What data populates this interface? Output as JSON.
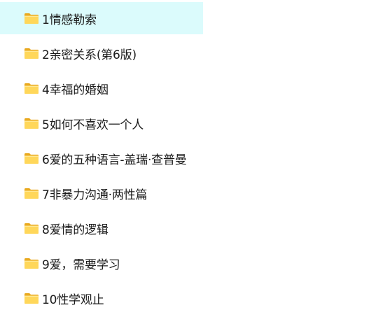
{
  "folders": [
    {
      "name": "1情感勒索",
      "selected": true
    },
    {
      "name": "2亲密关系(第6版)",
      "selected": false
    },
    {
      "name": "4幸福的婚姻",
      "selected": false
    },
    {
      "name": "5如何不喜欢一个人",
      "selected": false
    },
    {
      "name": "6爱的五种语言-盖瑞·查普曼",
      "selected": false
    },
    {
      "name": "7非暴力沟通·两性篇",
      "selected": false
    },
    {
      "name": "8爱情的逻辑",
      "selected": false
    },
    {
      "name": "9爱，需要学习",
      "selected": false
    },
    {
      "name": "10性学观止",
      "selected": false
    }
  ],
  "icon": "folder-icon",
  "colors": {
    "selection": "#dbfbfc",
    "folder_front": "#ffd75a",
    "folder_back": "#f0b429",
    "text": "#1b1b1b"
  }
}
